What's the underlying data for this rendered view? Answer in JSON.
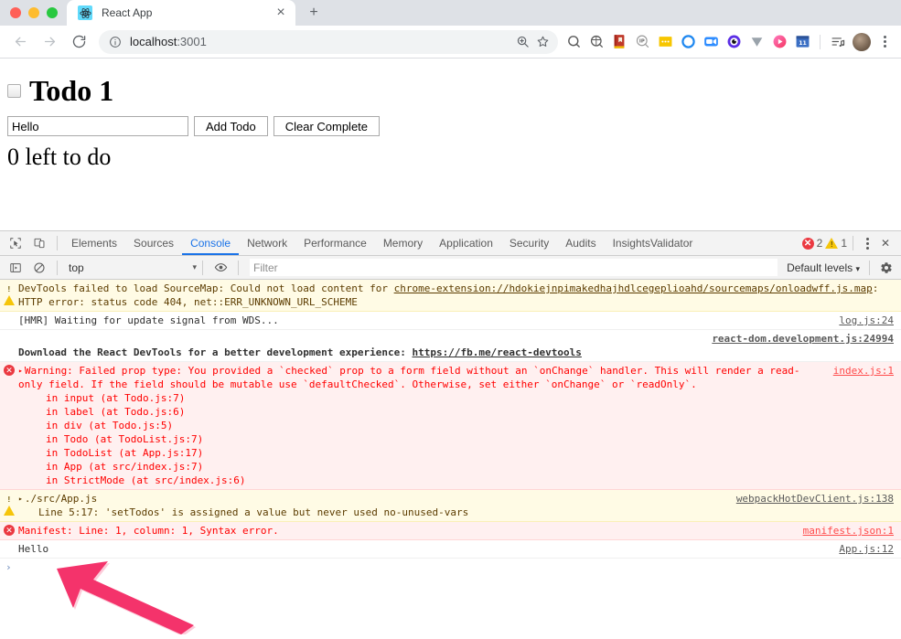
{
  "browser": {
    "traffic_lights": [
      "close",
      "minimize",
      "zoom"
    ],
    "tab": {
      "title": "React App",
      "favicon": "react-logo-icon",
      "close_label": "×"
    },
    "new_tab_label": "+",
    "nav": {
      "back": "←",
      "forward": "→",
      "reload": "⟳"
    },
    "omnibox": {
      "info_icon": "page-info-icon",
      "url_host": "localhost",
      "url_port": ":3001",
      "zoom_icon": "zoom-in-icon",
      "bookmark_icon": "star-icon"
    },
    "extensions": [
      {
        "name": "quetext-extension",
        "glyph": "Q",
        "color": "#5a5a5a"
      },
      {
        "name": "loom-extension",
        "glyph": "◔",
        "color": "#5a5a5a"
      },
      {
        "name": "dictionary-extension",
        "glyph": "█",
        "color": "#c0392b"
      },
      {
        "name": "ip-lookup-extension",
        "glyph": "IP",
        "color": "#8a8a8a"
      },
      {
        "name": "honey-extension",
        "glyph": "⋯",
        "color": "#f7c600"
      },
      {
        "name": "grammarly-extension",
        "glyph": "◯",
        "color": "#1e87f0"
      },
      {
        "name": "zoom-meeting-extension",
        "glyph": "▣",
        "color": "#2d8cff"
      },
      {
        "name": "eye-dropper-extension",
        "glyph": "◉",
        "color": "#5b2ee5"
      },
      {
        "name": "vimeo-extension",
        "glyph": "▼",
        "color": "#9aa3ab"
      },
      {
        "name": "video-player-extension",
        "glyph": "▶",
        "color": "#f54ea2"
      },
      {
        "name": "calendar-extension",
        "glyph": "11",
        "color": "#2f6fc0"
      }
    ],
    "avatar": "profile-avatar",
    "menu": "browser-menu-icon"
  },
  "page": {
    "todo_item": {
      "checked": false,
      "label": "Todo 1"
    },
    "input": {
      "value": "Hello",
      "placeholder": ""
    },
    "add_button": "Add Todo",
    "clear_button": "Clear Complete",
    "count_text": "0 left to do"
  },
  "devtools": {
    "inspect_icon": "inspect-element-icon",
    "device_icon": "device-toolbar-icon",
    "tabs": [
      {
        "label": "Elements",
        "active": false
      },
      {
        "label": "Sources",
        "active": false
      },
      {
        "label": "Console",
        "active": true
      },
      {
        "label": "Network",
        "active": false
      },
      {
        "label": "Performance",
        "active": false
      },
      {
        "label": "Memory",
        "active": false
      },
      {
        "label": "Application",
        "active": false
      },
      {
        "label": "Security",
        "active": false
      },
      {
        "label": "Audits",
        "active": false
      },
      {
        "label": "InsightsValidator",
        "active": false
      }
    ],
    "error_count": "2",
    "warning_count": "1",
    "more_label": "⋮",
    "close_label": "✕",
    "console_toolbar": {
      "sidebar_icon": "console-sidebar-icon",
      "clear_icon": "clear-console-icon",
      "context": "top",
      "context_caret": "▾",
      "eye_icon": "live-expression-icon",
      "filter_placeholder": "Filter",
      "filter_value": "",
      "levels_label": "Default levels",
      "levels_caret": "▾",
      "settings_icon": "console-settings-icon"
    },
    "messages": [
      {
        "type": "warn",
        "icon": "warning-icon",
        "text_before": "DevTools failed to load SourceMap: Could not load content for ",
        "link": "chrome-extension://hdokiejnpimakedhajhdlcegeplioahd/sourcemaps/onloadwff.js.map",
        "text_after": ": HTTP error: status code 404, net::ERR_UNKNOWN_URL_SCHEME",
        "source": ""
      },
      {
        "type": "plain",
        "icon": "",
        "text": "[HMR] Waiting for update signal from WDS...",
        "source": "log.js:24"
      },
      {
        "type": "plain-bold",
        "icon": "",
        "text_before": "Download the React DevTools for a better development experience: ",
        "link": "https://fb.me/react-devtools",
        "source": "react-dom.development.js:24994"
      },
      {
        "type": "error",
        "icon": "error-icon",
        "disclosure": "▸",
        "text": "Warning: Failed prop type: You provided a `checked` prop to a form field without an `onChange` handler. This will render a read-only field. If the field should be mutable use `defaultChecked`. Otherwise, set either `onChange` or `readOnly`.",
        "stack": [
          "in input (at Todo.js:7)",
          "in label (at Todo.js:6)",
          "in div (at Todo.js:5)",
          "in Todo (at TodoList.js:7)",
          "in TodoList (at App.js:17)",
          "in App (at src/index.js:7)",
          "in StrictMode (at src/index.js:6)"
        ],
        "source": "index.js:1"
      },
      {
        "type": "warn",
        "icon": "warning-icon",
        "disclosure": "▸",
        "text": "./src/App.js",
        "sub_text": "Line 5:17:  'setTodos' is assigned a value but never used  no-unused-vars",
        "source": "webpackHotDevClient.js:138"
      },
      {
        "type": "error",
        "icon": "error-icon",
        "text": "Manifest: Line: 1, column: 1, Syntax error.",
        "source": "manifest.json:1"
      },
      {
        "type": "plain",
        "icon": "",
        "text": "Hello",
        "source": "App.js:12"
      }
    ],
    "prompt": {
      "chevron": "›",
      "value": ""
    }
  },
  "annotation": {
    "arrow": "pink-arrow-annotation",
    "color": "#f4336b"
  }
}
